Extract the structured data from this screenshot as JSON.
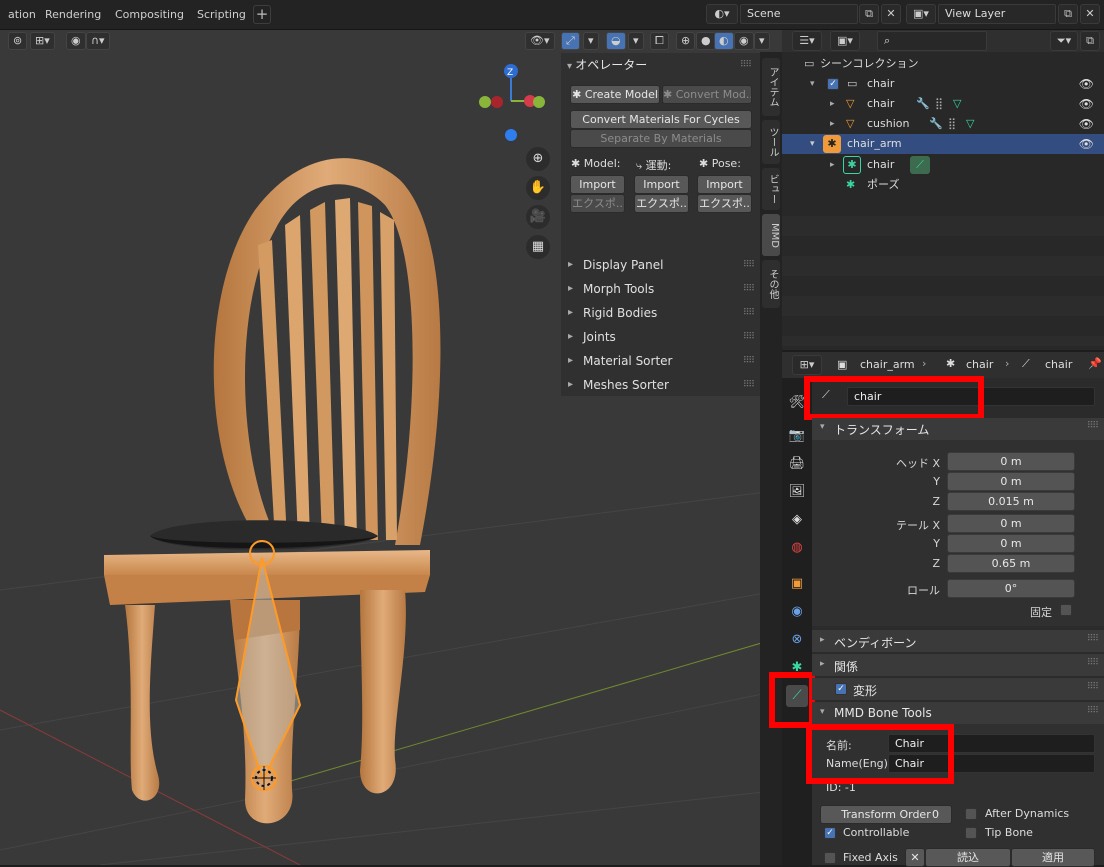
{
  "topbar": {
    "tabs": [
      "ation",
      "Rendering",
      "Compositing",
      "Scripting"
    ],
    "plus": "+",
    "scene": "Scene",
    "view_layer": "View Layer"
  },
  "operator": {
    "title": "オペレーター",
    "create_model": "Create Model",
    "convert_model": "Convert Mod..",
    "convert_materials": "Convert Materials For Cycles",
    "separate": "Separate By Materials",
    "model": "Model:",
    "motion": "運動:",
    "pose": "Pose:",
    "import": "Import",
    "export": "エクスポ..",
    "subpanels": [
      "Display Panel",
      "Morph Tools",
      "Rigid Bodies",
      "Joints",
      "Material Sorter",
      "Meshes Sorter"
    ]
  },
  "sidebar_tabs": [
    "アイテム",
    "ツール",
    "ビュー",
    "MMD",
    "その他"
  ],
  "gizmo": {
    "z": "Z"
  },
  "outliner": {
    "collection": "シーンコレクション",
    "chair": "chair",
    "chair_mesh": "chair",
    "cushion": "cushion",
    "chair_arm": "chair_arm",
    "armature": "chair",
    "pose": "ポーズ"
  },
  "props": {
    "crumb_obj": "chair_arm",
    "crumb_arm": "chair",
    "crumb_bone": "chair",
    "name": "chair",
    "transform": "トランスフォーム",
    "head_x": "ヘッド X",
    "y": "Y",
    "z": "Z",
    "tail_x": "テール X",
    "roll": "ロール",
    "lock": "固定",
    "vals": {
      "hx": "0 m",
      "hy": "0 m",
      "hz": "0.015 m",
      "tx": "0 m",
      "ty": "0 m",
      "tz": "0.65 m",
      "roll": "0°"
    },
    "bendy": "ベンディボーン",
    "relations": "関係",
    "deform": "変形",
    "mmd_tools": "MMD Bone Tools",
    "name_label": "名前:",
    "name_eng_label": "Name(Eng):",
    "name_j": "Chair",
    "name_e": "Chair",
    "id": "ID: -1",
    "transform_order": "Transform Order",
    "transform_order_val": "0",
    "after_dynamics": "After Dynamics",
    "controllable": "Controllable",
    "tip_bone": "Tip Bone",
    "fixed_axis": "Fixed Axis",
    "read": "読込",
    "apply": "適用"
  },
  "colors": {
    "highlight": "#ff0000",
    "select": "#334d80",
    "bone": "#ff9a26",
    "wood": "#d9a06b"
  }
}
